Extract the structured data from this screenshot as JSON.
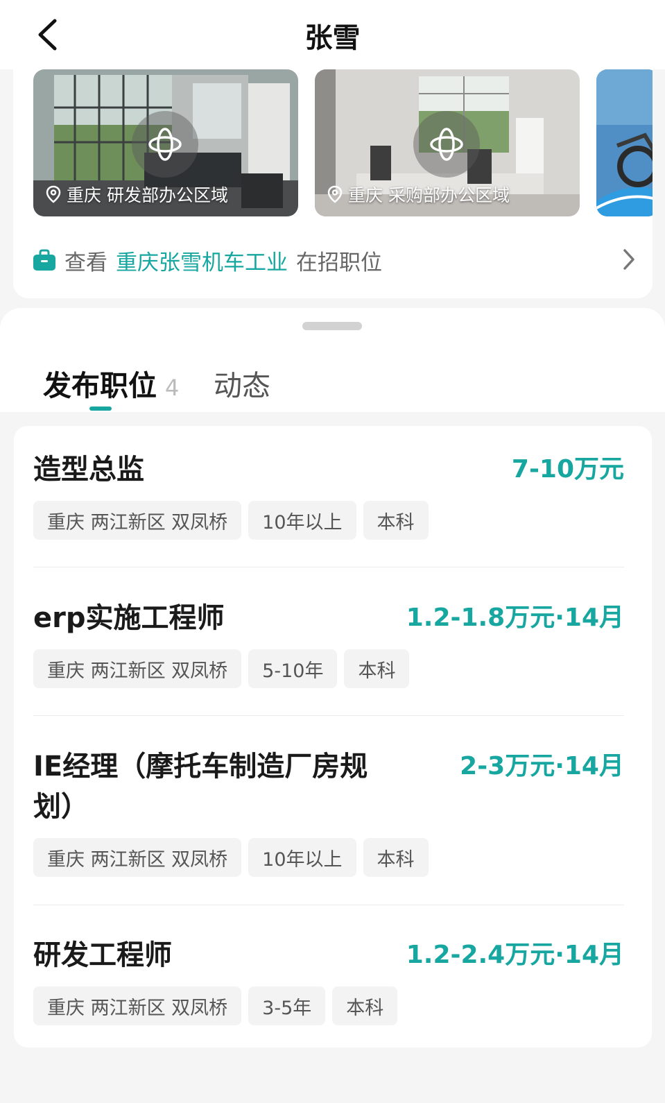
{
  "nav": {
    "title": "张雪"
  },
  "gallery": [
    {
      "location": "重庆",
      "area": "研发部办公区域"
    },
    {
      "location": "重庆",
      "area": "采购部办公区域"
    }
  ],
  "jobs_link": {
    "prefix": "查看",
    "company": "重庆张雪机车工业",
    "suffix": "在招职位"
  },
  "tabs": {
    "active_label": "发布职位",
    "active_count": "4",
    "second_label": "动态"
  },
  "jobs": [
    {
      "title": "造型总监",
      "salary": "7-10万元",
      "tags": [
        "重庆 两江新区 双凤桥",
        "10年以上",
        "本科"
      ]
    },
    {
      "title": "erp实施工程师",
      "salary": "1.2-1.8万元·14月",
      "tags": [
        "重庆 两江新区 双凤桥",
        "5-10年",
        "本科"
      ]
    },
    {
      "title_line1": "IE经理（摩托车制造厂房规",
      "title_line2": "划）",
      "salary": "2-3万元·14月",
      "tags": [
        "重庆 两江新区 双凤桥",
        "10年以上",
        "本科"
      ]
    },
    {
      "title": "研发工程师",
      "salary": "1.2-2.4万元·14月",
      "tags": [
        "重庆 两江新区 双凤桥",
        "3-5年",
        "本科"
      ]
    }
  ],
  "colors": {
    "accent": "#17a6a0",
    "tag_bg": "#f3f3f3",
    "page_bg": "#f5f5f5"
  },
  "icons": [
    "back-arrow-icon",
    "panorama-icon",
    "location-pin-icon",
    "briefcase-icon",
    "chevron-right-icon"
  ]
}
